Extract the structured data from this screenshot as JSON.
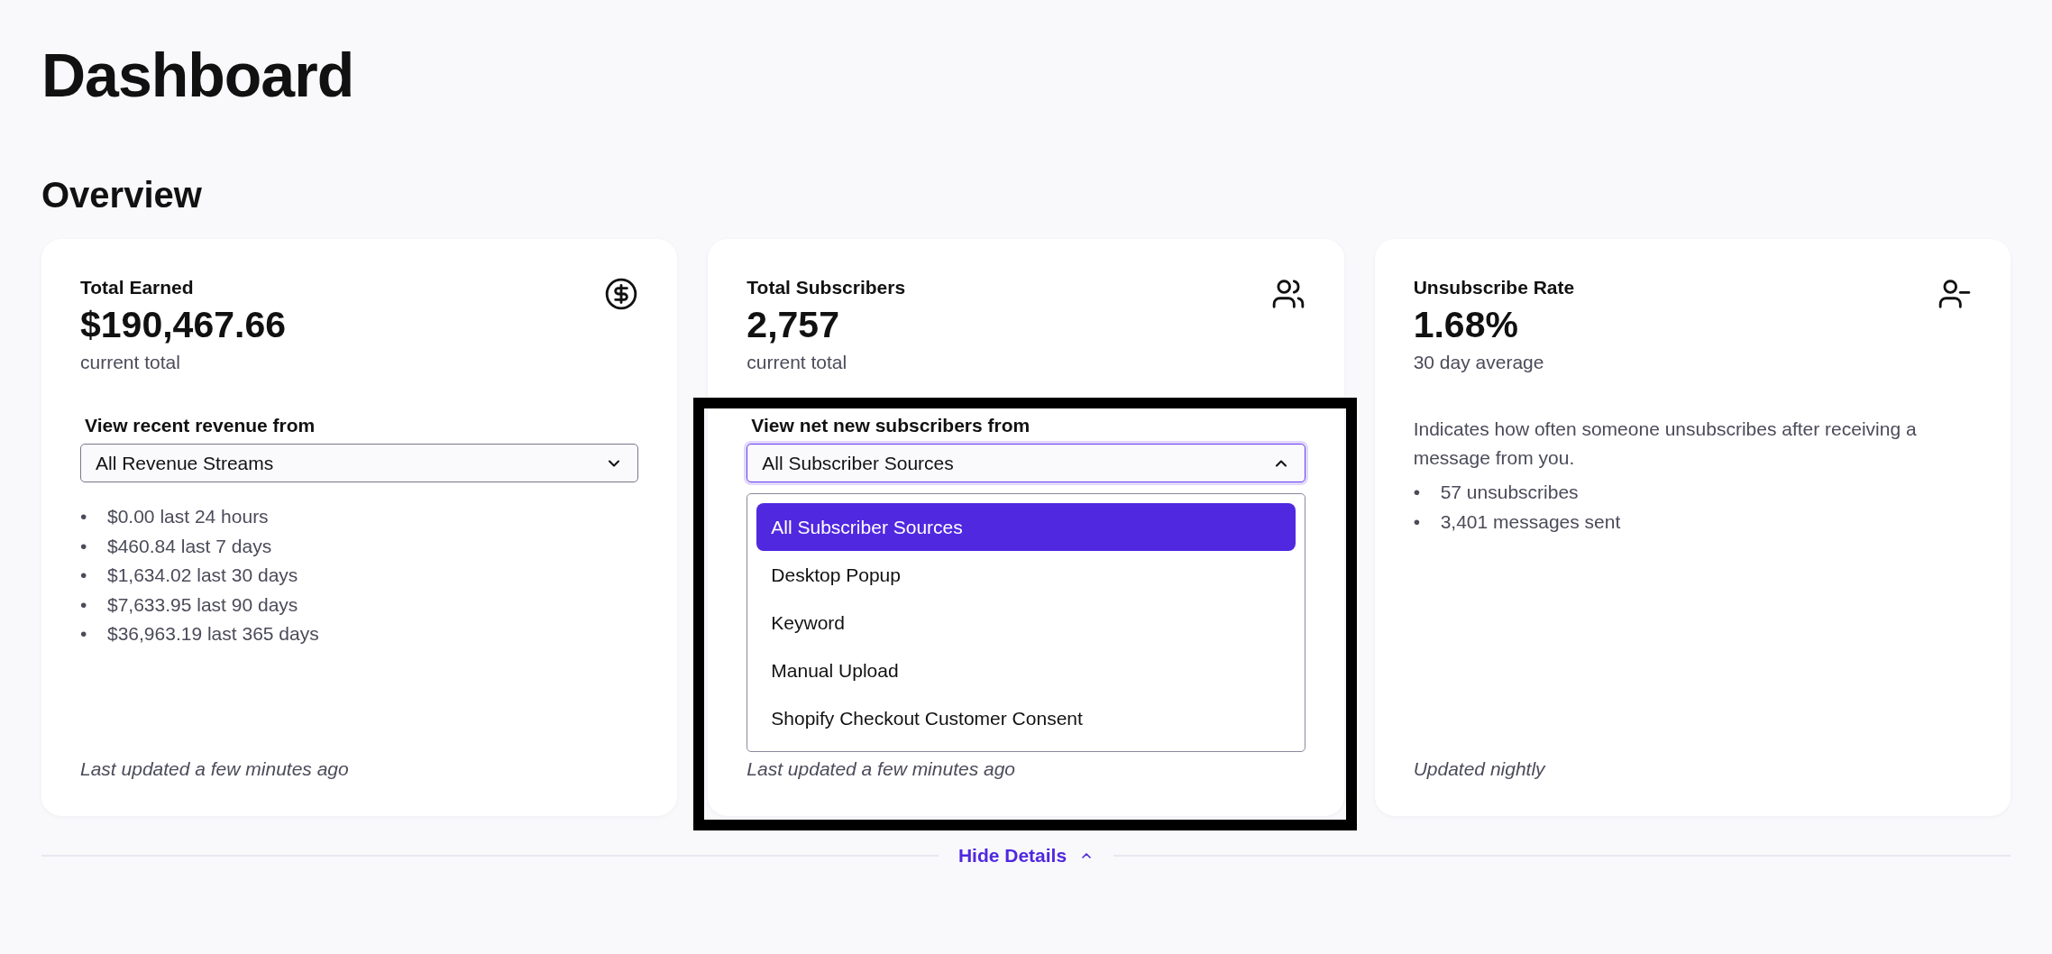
{
  "page": {
    "title": "Dashboard"
  },
  "overview": {
    "heading": "Overview",
    "cards": [
      {
        "kind": "revenue",
        "title": "Total Earned",
        "value": "$190,467.66",
        "caption": "current total",
        "select": {
          "label": "View recent revenue from",
          "value": "All Revenue Streams",
          "open": false
        },
        "bullets": [
          {
            "marker": "•",
            "text": "$0.00 last 24 hours"
          },
          {
            "marker": "•",
            "text": "$460.84 last 7 days"
          },
          {
            "marker": "•",
            "text": "$1,634.02 last 30 days"
          },
          {
            "marker": "•",
            "text": "$7,633.95 last 90 days"
          },
          {
            "marker": "•",
            "text": "$36,963.19 last 365 days"
          }
        ],
        "footer": "Last updated a few minutes ago",
        "highlighted": false
      },
      {
        "kind": "subscribers",
        "title": "Total Subscribers",
        "value": "2,757",
        "caption": "current total",
        "select": {
          "label": "View net new subscribers from",
          "value": "All Subscriber Sources",
          "open": true,
          "options": [
            {
              "label": "All Subscriber Sources",
              "selected": true
            },
            {
              "label": "Desktop Popup",
              "selected": false
            },
            {
              "label": "Keyword",
              "selected": false
            },
            {
              "label": "Manual Upload",
              "selected": false
            },
            {
              "label": "Shopify Checkout Customer Consent",
              "selected": false
            }
          ]
        },
        "footer": "Last updated a few minutes ago",
        "highlighted": true
      },
      {
        "kind": "unsubscribe",
        "title": "Unsubscribe Rate",
        "value": "1.68%",
        "caption": "30 day average",
        "description": "Indicates how often someone unsubscribes after receiving a message from you.",
        "bullets": [
          {
            "marker": "•",
            "text": "57 unsubscribes"
          },
          {
            "marker": "•",
            "text": "3,401 messages sent"
          }
        ],
        "footer": "Updated nightly",
        "highlighted": false
      }
    ]
  },
  "toggle": {
    "label": "Hide Details",
    "expanded": true
  }
}
